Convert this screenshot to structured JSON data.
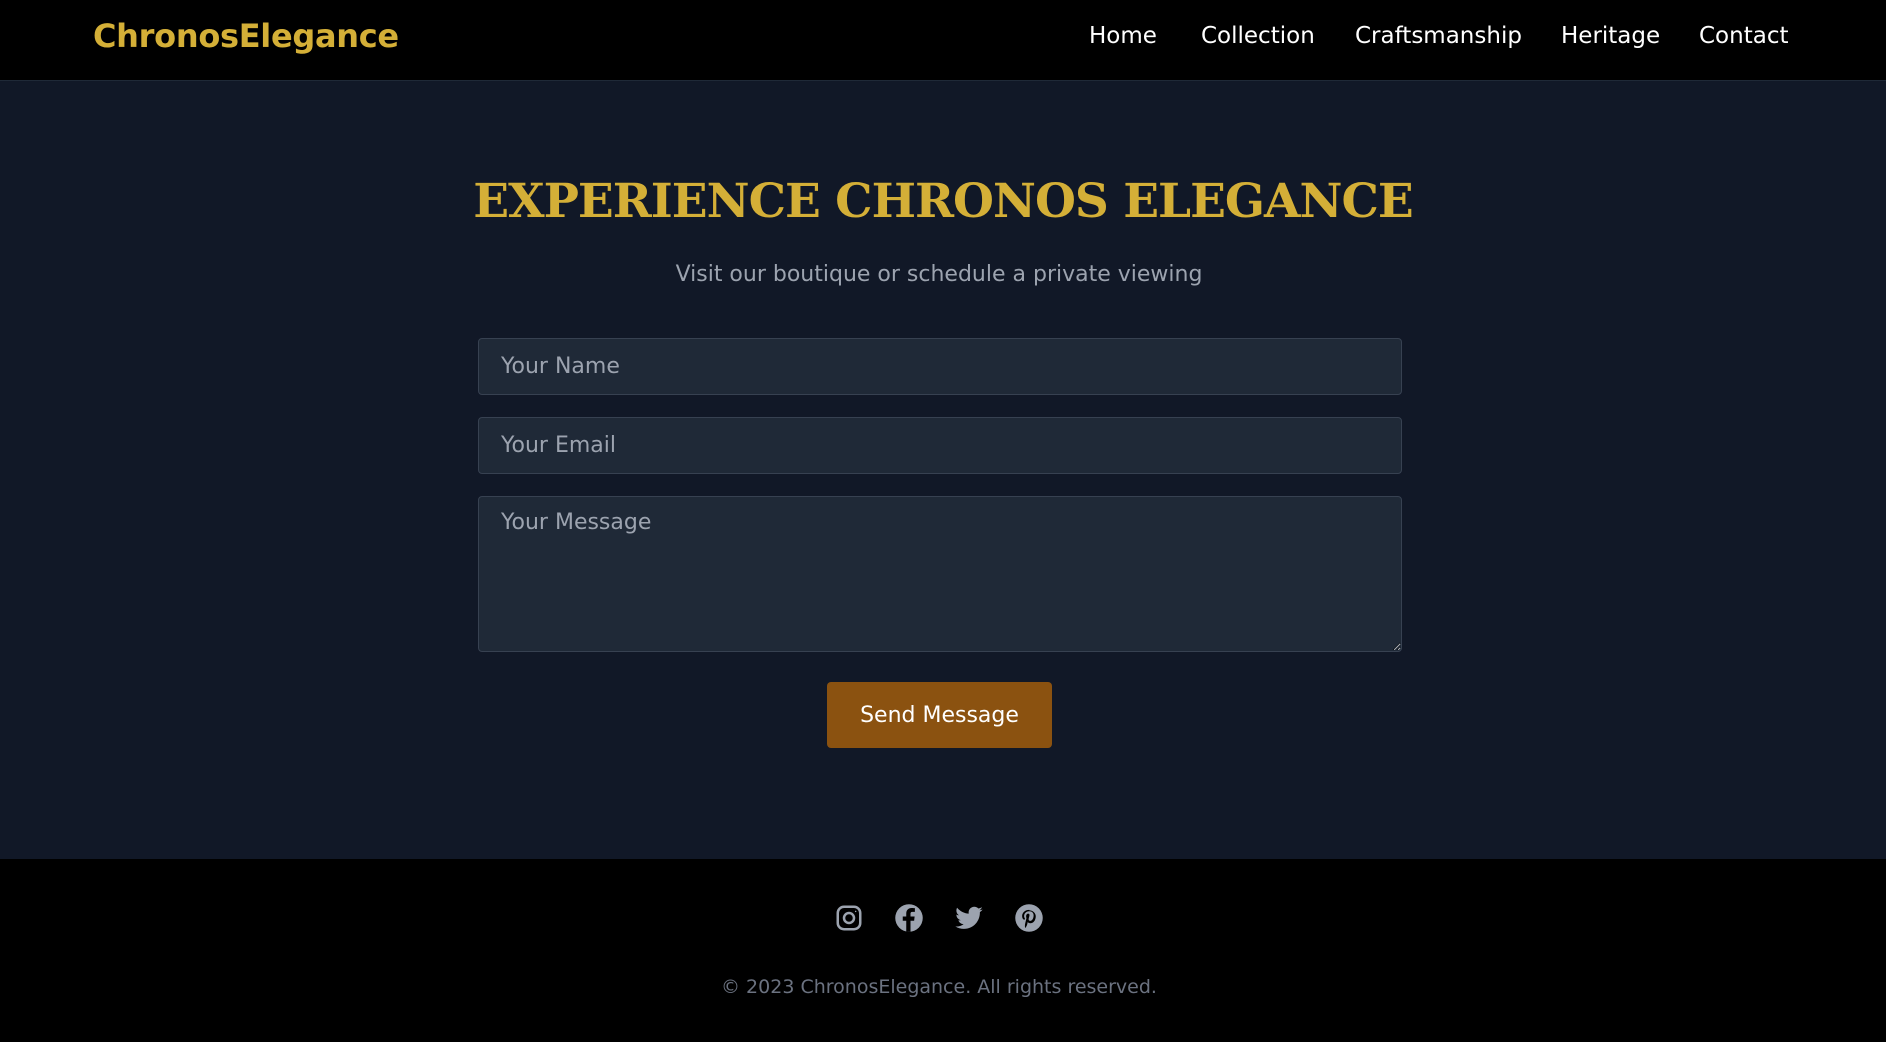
{
  "header": {
    "logo": "ChronosElegance",
    "nav": [
      "Home",
      "Collection",
      "Craftsmanship",
      "Heritage",
      "Contact"
    ]
  },
  "contact": {
    "title": "EXPERIENCE CHRONOS ELEGANCE",
    "subtitle": "Visit our boutique or schedule a private viewing",
    "name_placeholder": "Your Name",
    "email_placeholder": "Your Email",
    "message_placeholder": "Your Message",
    "submit_label": "Send Message"
  },
  "footer": {
    "social_icons": [
      "instagram-icon",
      "facebook-icon",
      "twitter-icon",
      "pinterest-icon"
    ],
    "copyright": "© 2023 ChronosElegance. All rights reserved."
  },
  "colors": {
    "accent_gold": "#d4af37",
    "button_bronze": "#8b5210",
    "background": "#111827",
    "field_background": "#1f2937",
    "header_footer": "#000000"
  }
}
